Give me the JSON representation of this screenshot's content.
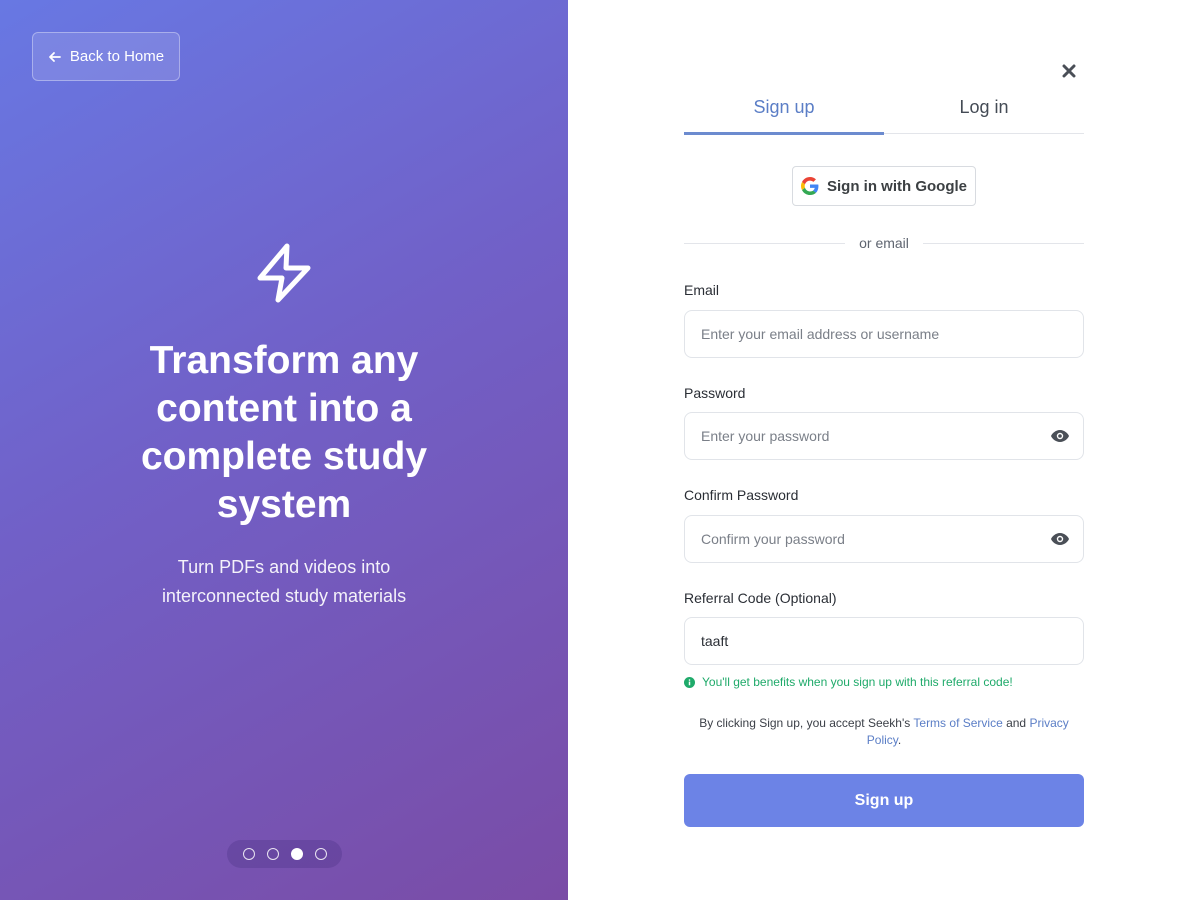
{
  "hero": {
    "back_label": "Back to Home",
    "title": "Transform any content into a complete study system",
    "subtitle": "Turn PDFs and videos into interconnected study materials",
    "carousel": {
      "total": 4,
      "active_index": 2
    }
  },
  "auth": {
    "tabs": [
      {
        "label": "Sign up",
        "active": true
      },
      {
        "label": "Log in",
        "active": false
      }
    ],
    "google_label": "Sign in with Google",
    "divider_text": "or email",
    "fields": {
      "email": {
        "label": "Email",
        "placeholder": "Enter your email address or username",
        "value": ""
      },
      "password": {
        "label": "Password",
        "placeholder": "Enter your password",
        "value": ""
      },
      "confirm_password": {
        "label": "Confirm Password",
        "placeholder": "Confirm your password",
        "value": ""
      },
      "referral": {
        "label": "Referral Code (Optional)",
        "placeholder": "",
        "value": "taaft"
      }
    },
    "referral_hint": "You'll get benefits when you sign up with this referral code!",
    "terms": {
      "prefix": "By clicking Sign up, you accept Seekh's ",
      "tos_link": "Terms of Service",
      "middle": " and ",
      "privacy_link": "Privacy Policy",
      "suffix": "."
    },
    "submit_label": "Sign up"
  },
  "colors": {
    "accent": "#6c83e6",
    "tab_active": "#5b7ec6",
    "success": "#1faa6a",
    "gradient_start": "#6878e3",
    "gradient_end": "#7a4ca6"
  },
  "icons": {
    "back": "arrow-left-icon",
    "hero": "lightning-bolt-icon",
    "close": "close-icon",
    "google": "google-logo-icon",
    "eye": "eye-icon",
    "info": "info-circle-icon"
  }
}
